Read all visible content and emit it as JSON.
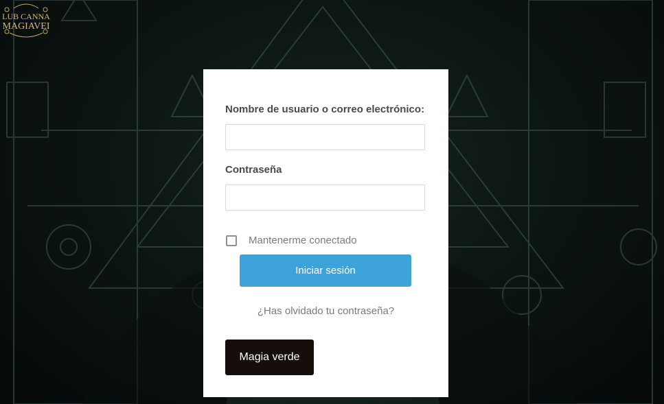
{
  "logo": {
    "line1": "LUB CANNA",
    "line2": "MAGIAVEI"
  },
  "form": {
    "username_label": "Nombre de usuario o correo electrónico:",
    "username_value": "",
    "password_label": "Contraseña",
    "password_value": "",
    "remember_label": "Mantenerme conectado",
    "remember_checked": false,
    "submit_label": "Iniciar sesión",
    "forgot_label": "¿Has olvidado tu contraseña?",
    "extra_button_label": "Magia verde"
  },
  "colors": {
    "submit_button": "#3ea3da",
    "extra_button": "#150e0a",
    "background": "#0f1a18",
    "logo_gold": "#d8b968"
  }
}
